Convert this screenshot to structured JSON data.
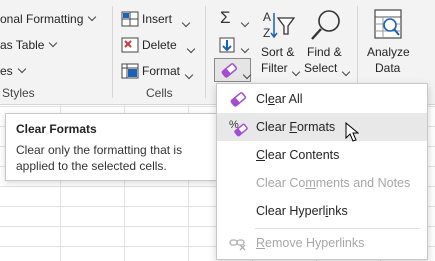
{
  "ribbon": {
    "styles_group": {
      "conditional_formatting": "onal Formatting",
      "format_as_table": "as Table",
      "cell_styles": "es",
      "group_label": "Styles"
    },
    "cells_group": {
      "insert": "Insert",
      "delete": "Delete",
      "format": "Format",
      "group_label": "Cells"
    },
    "editing_group": {
      "sort_filter_line1": "Sort &",
      "sort_filter_line2": "Filter",
      "find_select_line1": "Find &",
      "find_select_line2": "Select"
    },
    "analysis_group": {
      "analyze_line1": "Analyze",
      "analyze_line2": "Data"
    },
    "icons": {
      "autosum": "sigma-icon",
      "fill": "fill-down-icon",
      "clear": "eraser-icon",
      "sort_filter": "sort-filter-icon",
      "find_select": "magnifier-icon",
      "analyze_data": "analyze-data-icon"
    }
  },
  "clear_menu": {
    "items": [
      {
        "pre": "Cl",
        "accel": "e",
        "post": "ar All",
        "enabled": true,
        "icon": "eraser-icon"
      },
      {
        "pre": "Clear ",
        "accel": "F",
        "post": "ormats",
        "enabled": true,
        "hovered": true,
        "icon": "clear-formats-icon"
      },
      {
        "pre": "",
        "accel": "C",
        "post": "lear Contents",
        "enabled": true
      },
      {
        "pre": "Clear Co",
        "accel": "m",
        "post": "ments and Notes",
        "enabled": false
      },
      {
        "pre": "Clear Hyperl",
        "accel": "i",
        "post": "nks",
        "enabled": true
      },
      {
        "pre": "",
        "accel": "R",
        "post": "emove Hyperlinks",
        "enabled": false,
        "icon": "remove-hyperlink-icon"
      }
    ]
  },
  "tooltip": {
    "title": "Clear Formats",
    "description": "Clear only the formatting that is applied to the selected cells."
  },
  "colors": {
    "ribbon_bg": "#f3f3f3",
    "accent_purple": "#a64bd6",
    "icon_blue": "#1b62b7",
    "disabled_text": "#a6a6a6"
  }
}
